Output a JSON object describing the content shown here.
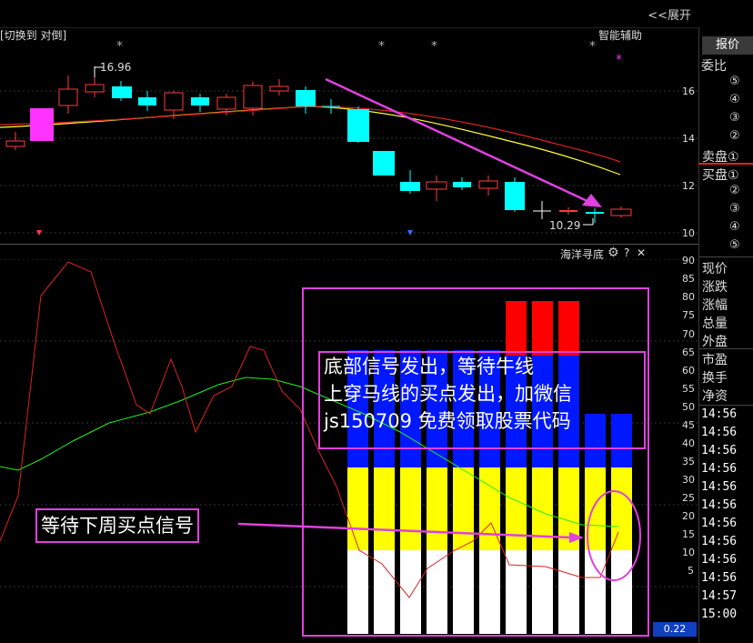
{
  "header": {
    "expand_label": "<<展开"
  },
  "candle_panel": {
    "title": "[切换到 对倒]",
    "assist_label": "智能辅助",
    "high_label": "16.96",
    "low_label": "10.29",
    "axis": [
      "16",
      "14",
      "12",
      "10"
    ]
  },
  "indicator_panel": {
    "title": "海洋寻底",
    "gear_icon": "gear-icon",
    "help_label": "?",
    "close_label": "✕",
    "axis": [
      "90",
      "85",
      "80",
      "75",
      "70",
      "65",
      "60",
      "55",
      "50",
      "45",
      "40",
      "35",
      "30",
      "25",
      "20",
      "15",
      "10",
      "5"
    ],
    "value_badge": "0.22"
  },
  "right_panel": {
    "quote_tab": "报价",
    "ratio_label": "委比",
    "sell_labels": [
      "⑤",
      "④",
      "③",
      "②",
      "卖盘①"
    ],
    "buy_labels": [
      "买盘①",
      "②",
      "③",
      "④",
      "⑤"
    ],
    "stats": [
      "现价",
      "涨跌",
      "涨幅",
      "总量",
      "外盘",
      "市盈",
      "换手",
      "净资"
    ],
    "times": [
      "14:56",
      "14:56",
      "14:56",
      "14:56",
      "14:56",
      "14:56",
      "14:56",
      "14:56",
      "14:56",
      "14:56",
      "14:57",
      "15:00"
    ]
  },
  "annotations": {
    "main_lines": [
      "底部信号发出，等待牛线",
      "上穿马线的买点发出，加微信",
      "js150709 免费领取股票代码"
    ],
    "wait_text": "等待下周买点信号"
  },
  "colors": {
    "up": "#ff3b3b",
    "down": "#00ffff",
    "magenta": "#e040e0",
    "ma_fast": "#ffff33",
    "ma_slow": "#dd2222"
  }
}
